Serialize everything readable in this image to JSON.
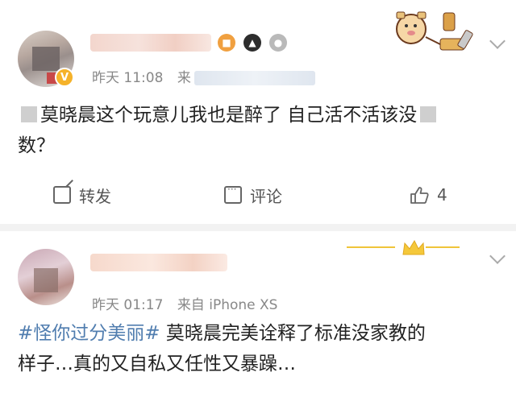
{
  "posts": [
    {
      "time": "昨天 11:08",
      "source_prefix": "来",
      "text": "莫晓晨这个玩意儿我也是醉了 自己活不活该没",
      "text_line2": "数？",
      "actions": {
        "repost": "转发",
        "comment": "评论",
        "like_count": "4"
      },
      "verified_label": "V"
    },
    {
      "time": "昨天 01:17",
      "source": "来自 iPhone XS",
      "hashtag": "#怪你过分美丽#",
      "text": " 莫晓晨完美诠释了标准没家教的",
      "text_line2": "样子…真的又自私又任性又暴躁…"
    }
  ],
  "icons": [
    "share-icon",
    "comment-icon",
    "like-icon",
    "chevron-down-icon"
  ],
  "colors": {
    "hashtag": "#507daf",
    "verified_badge": "#f5b22a",
    "background": "#f2f2f2"
  }
}
